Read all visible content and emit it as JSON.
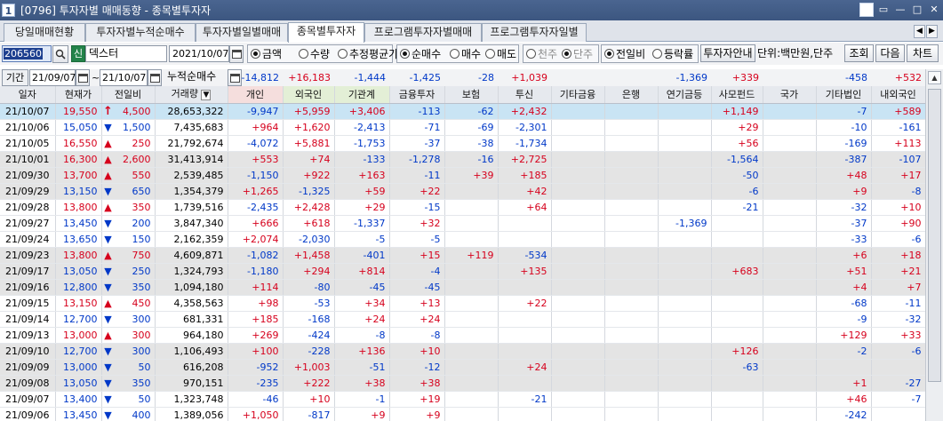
{
  "window": {
    "number": "1",
    "title": "[0796] 투자자별 매매동향 - 종목별투자자",
    "buttons": [
      "◀",
      "m",
      "▭",
      "—",
      "□",
      "✕"
    ]
  },
  "tabs": [
    {
      "label": "당일매매현황",
      "active": false
    },
    {
      "label": "투자자별누적순매수",
      "active": false
    },
    {
      "label": "투자자별일별매매",
      "active": false
    },
    {
      "label": "종목별투자자",
      "active": true
    },
    {
      "label": "프로그램투자자별매매",
      "active": false
    },
    {
      "label": "프로그램투자자일별",
      "active": false
    }
  ],
  "controls": {
    "stock_code": "206560",
    "credit_badge": "신",
    "stock_name": "덱스터",
    "date": "2021/10/07",
    "radio_group1": [
      {
        "label": "금액",
        "on": true
      },
      {
        "label": "수량",
        "on": false
      },
      {
        "label": "추정평균가",
        "on": false
      }
    ],
    "radio_group2": [
      {
        "label": "순매수",
        "on": true
      },
      {
        "label": "매수",
        "on": false
      },
      {
        "label": "매도",
        "on": false
      }
    ],
    "radio_group3": [
      {
        "label": "천주",
        "on": false
      },
      {
        "label": "단주",
        "on": true
      }
    ],
    "radio_group4": [
      {
        "label": "전일비",
        "on": true
      },
      {
        "label": "등락률",
        "on": false
      }
    ],
    "guide_button": "투자자안내",
    "unit_text": "단위:백만원,단주",
    "query_button": "조회",
    "next_button": "다음",
    "chart_button": "차트",
    "period_label": "기간",
    "period_from": "21/09/07",
    "period_sep": "~",
    "period_to": "21/10/07",
    "cum_label": "누적순매수"
  },
  "cumulative": {
    "individual": "-14,812",
    "foreign": "+16,183",
    "institution": "-1,444",
    "financial": "-1,425",
    "insurance": "-28",
    "trust": "+1,039",
    "other_fin": "",
    "bank": "",
    "pension": "-1,369",
    "private_fund": "+339",
    "nation": "",
    "other_corp": "-458",
    "domestic_foreign": "+532"
  },
  "columns": [
    "일자",
    "현재가",
    "전일비",
    "거래량",
    "개인",
    "외국인",
    "기관계",
    "금융투자",
    "보험",
    "투신",
    "기타금융",
    "은행",
    "연기금등",
    "사모펀드",
    "국가",
    "기타법인",
    "내외국인"
  ],
  "rows": [
    {
      "date": "21/10/07",
      "price": "19,550",
      "dir": "up-arrow",
      "chg": "4,500",
      "vol": "28,653,322",
      "ind": "-9,947",
      "for": "+5,959",
      "inst": "+3,406",
      "fin": "-113",
      "ins": "-62",
      "trust": "+2,432",
      "ofin": "",
      "bank": "",
      "pen": "",
      "pf": "+1,149",
      "nat": "",
      "ocorp": "-7",
      "df": "+589",
      "style": "sel"
    },
    {
      "date": "21/10/06",
      "price": "15,050",
      "dir": "down",
      "chg": "1,500",
      "vol": "7,435,683",
      "ind": "+964",
      "for": "+1,620",
      "inst": "-2,413",
      "fin": "-71",
      "ins": "-69",
      "trust": "-2,301",
      "ofin": "",
      "bank": "",
      "pen": "",
      "pf": "+29",
      "nat": "",
      "ocorp": "-10",
      "df": "-161",
      "style": ""
    },
    {
      "date": "21/10/05",
      "price": "16,550",
      "dir": "up",
      "chg": "250",
      "vol": "21,792,674",
      "ind": "-4,072",
      "for": "+5,881",
      "inst": "-1,753",
      "fin": "-37",
      "ins": "-38",
      "trust": "-1,734",
      "ofin": "",
      "bank": "",
      "pen": "",
      "pf": "+56",
      "nat": "",
      "ocorp": "-169",
      "df": "+113",
      "style": ""
    },
    {
      "date": "21/10/01",
      "price": "16,300",
      "dir": "up",
      "chg": "2,600",
      "vol": "31,413,914",
      "ind": "+553",
      "for": "+74",
      "inst": "-133",
      "fin": "-1,278",
      "ins": "-16",
      "trust": "+2,725",
      "ofin": "",
      "bank": "",
      "pen": "",
      "pf": "-1,564",
      "nat": "",
      "ocorp": "-387",
      "df": "-107",
      "style": "shade"
    },
    {
      "date": "21/09/30",
      "price": "13,700",
      "dir": "up",
      "chg": "550",
      "vol": "2,539,485",
      "ind": "-1,150",
      "for": "+922",
      "inst": "+163",
      "fin": "-11",
      "ins": "+39",
      "trust": "+185",
      "ofin": "",
      "bank": "",
      "pen": "",
      "pf": "-50",
      "nat": "",
      "ocorp": "+48",
      "df": "+17",
      "style": "shade"
    },
    {
      "date": "21/09/29",
      "price": "13,150",
      "dir": "down",
      "chg": "650",
      "vol": "1,354,379",
      "ind": "+1,265",
      "for": "-1,325",
      "inst": "+59",
      "fin": "+22",
      "ins": "",
      "trust": "+42",
      "ofin": "",
      "bank": "",
      "pen": "",
      "pf": "-6",
      "nat": "",
      "ocorp": "+9",
      "df": "-8",
      "style": "shade"
    },
    {
      "date": "21/09/28",
      "price": "13,800",
      "dir": "up",
      "chg": "350",
      "vol": "1,739,516",
      "ind": "-2,435",
      "for": "+2,428",
      "inst": "+29",
      "fin": "-15",
      "ins": "",
      "trust": "+64",
      "ofin": "",
      "bank": "",
      "pen": "",
      "pf": "-21",
      "nat": "",
      "ocorp": "-32",
      "df": "+10",
      "style": ""
    },
    {
      "date": "21/09/27",
      "price": "13,450",
      "dir": "down",
      "chg": "200",
      "vol": "3,847,340",
      "ind": "+666",
      "for": "+618",
      "inst": "-1,337",
      "fin": "+32",
      "ins": "",
      "trust": "",
      "ofin": "",
      "bank": "",
      "pen": "-1,369",
      "pf": "",
      "nat": "",
      "ocorp": "-37",
      "df": "+90",
      "style": ""
    },
    {
      "date": "21/09/24",
      "price": "13,650",
      "dir": "down",
      "chg": "150",
      "vol": "2,162,359",
      "ind": "+2,074",
      "for": "-2,030",
      "inst": "-5",
      "fin": "-5",
      "ins": "",
      "trust": "",
      "ofin": "",
      "bank": "",
      "pen": "",
      "pf": "",
      "nat": "",
      "ocorp": "-33",
      "df": "-6",
      "style": ""
    },
    {
      "date": "21/09/23",
      "price": "13,800",
      "dir": "up",
      "chg": "750",
      "vol": "4,609,871",
      "ind": "-1,082",
      "for": "+1,458",
      "inst": "-401",
      "fin": "+15",
      "ins": "+119",
      "trust": "-534",
      "ofin": "",
      "bank": "",
      "pen": "",
      "pf": "",
      "nat": "",
      "ocorp": "+6",
      "df": "+18",
      "style": "shade"
    },
    {
      "date": "21/09/17",
      "price": "13,050",
      "dir": "down",
      "chg": "250",
      "vol": "1,324,793",
      "ind": "-1,180",
      "for": "+294",
      "inst": "+814",
      "fin": "-4",
      "ins": "",
      "trust": "+135",
      "ofin": "",
      "bank": "",
      "pen": "",
      "pf": "+683",
      "nat": "",
      "ocorp": "+51",
      "df": "+21",
      "style": "shade"
    },
    {
      "date": "21/09/16",
      "price": "12,800",
      "dir": "down",
      "chg": "350",
      "vol": "1,094,180",
      "ind": "+114",
      "for": "-80",
      "inst": "-45",
      "fin": "-45",
      "ins": "",
      "trust": "",
      "ofin": "",
      "bank": "",
      "pen": "",
      "pf": "",
      "nat": "",
      "ocorp": "+4",
      "df": "+7",
      "style": "shade"
    },
    {
      "date": "21/09/15",
      "price": "13,150",
      "dir": "up",
      "chg": "450",
      "vol": "4,358,563",
      "ind": "+98",
      "for": "-53",
      "inst": "+34",
      "fin": "+13",
      "ins": "",
      "trust": "+22",
      "ofin": "",
      "bank": "",
      "pen": "",
      "pf": "",
      "nat": "",
      "ocorp": "-68",
      "df": "-11",
      "style": ""
    },
    {
      "date": "21/09/14",
      "price": "12,700",
      "dir": "down",
      "chg": "300",
      "vol": "681,331",
      "ind": "+185",
      "for": "-168",
      "inst": "+24",
      "fin": "+24",
      "ins": "",
      "trust": "",
      "ofin": "",
      "bank": "",
      "pen": "",
      "pf": "",
      "nat": "",
      "ocorp": "-9",
      "df": "-32",
      "style": ""
    },
    {
      "date": "21/09/13",
      "price": "13,000",
      "dir": "up",
      "chg": "300",
      "vol": "964,180",
      "ind": "+269",
      "for": "-424",
      "inst": "-8",
      "fin": "-8",
      "ins": "",
      "trust": "",
      "ofin": "",
      "bank": "",
      "pen": "",
      "pf": "",
      "nat": "",
      "ocorp": "+129",
      "df": "+33",
      "style": ""
    },
    {
      "date": "21/09/10",
      "price": "12,700",
      "dir": "down",
      "chg": "300",
      "vol": "1,106,493",
      "ind": "+100",
      "for": "-228",
      "inst": "+136",
      "fin": "+10",
      "ins": "",
      "trust": "",
      "ofin": "",
      "bank": "",
      "pen": "",
      "pf": "+126",
      "nat": "",
      "ocorp": "-2",
      "df": "-6",
      "style": "shade"
    },
    {
      "date": "21/09/09",
      "price": "13,000",
      "dir": "down",
      "chg": "50",
      "vol": "616,208",
      "ind": "-952",
      "for": "+1,003",
      "inst": "-51",
      "fin": "-12",
      "ins": "",
      "trust": "+24",
      "ofin": "",
      "bank": "",
      "pen": "",
      "pf": "-63",
      "nat": "",
      "ocorp": "",
      "df": "",
      "style": "shade"
    },
    {
      "date": "21/09/08",
      "price": "13,050",
      "dir": "down",
      "chg": "350",
      "vol": "970,151",
      "ind": "-235",
      "for": "+222",
      "inst": "+38",
      "fin": "+38",
      "ins": "",
      "trust": "",
      "ofin": "",
      "bank": "",
      "pen": "",
      "pf": "",
      "nat": "",
      "ocorp": "+1",
      "df": "-27",
      "style": "shade"
    },
    {
      "date": "21/09/07",
      "price": "13,400",
      "dir": "down",
      "chg": "50",
      "vol": "1,323,748",
      "ind": "-46",
      "for": "+10",
      "inst": "-1",
      "fin": "+19",
      "ins": "",
      "trust": "-21",
      "ofin": "",
      "bank": "",
      "pen": "",
      "pf": "",
      "nat": "",
      "ocorp": "+46",
      "df": "-7",
      "style": ""
    },
    {
      "date": "21/09/06",
      "price": "13,450",
      "dir": "down",
      "chg": "400",
      "vol": "1,389,056",
      "ind": "+1,050",
      "for": "-817",
      "inst": "+9",
      "fin": "+9",
      "ins": "",
      "trust": "",
      "ofin": "",
      "bank": "",
      "pen": "",
      "pf": "",
      "nat": "",
      "ocorp": "-242",
      "df": "",
      "style": ""
    }
  ],
  "colors": {
    "up": "#d6001c",
    "down": "#0038c8",
    "selected_row": "#c9e4f4",
    "title_bar": "#3c5680"
  }
}
